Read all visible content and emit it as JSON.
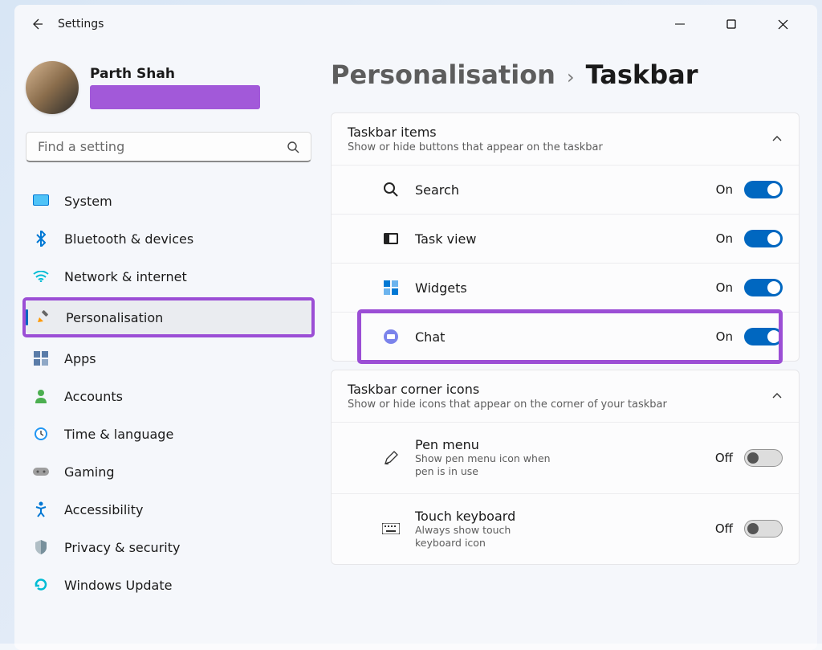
{
  "app_title": "Settings",
  "profile": {
    "name": "Parth Shah"
  },
  "search": {
    "placeholder": "Find a setting"
  },
  "sidebar": {
    "items": [
      {
        "label": "System"
      },
      {
        "label": "Bluetooth & devices"
      },
      {
        "label": "Network & internet"
      },
      {
        "label": "Personalisation"
      },
      {
        "label": "Apps"
      },
      {
        "label": "Accounts"
      },
      {
        "label": "Time & language"
      },
      {
        "label": "Gaming"
      },
      {
        "label": "Accessibility"
      },
      {
        "label": "Privacy & security"
      },
      {
        "label": "Windows Update"
      }
    ]
  },
  "breadcrumb": {
    "parent": "Personalisation",
    "current": "Taskbar"
  },
  "section1": {
    "title": "Taskbar items",
    "subtitle": "Show or hide buttons that appear on the taskbar",
    "rows": [
      {
        "label": "Search",
        "state": "On"
      },
      {
        "label": "Task view",
        "state": "On"
      },
      {
        "label": "Widgets",
        "state": "On"
      },
      {
        "label": "Chat",
        "state": "On"
      }
    ]
  },
  "section2": {
    "title": "Taskbar corner icons",
    "subtitle": "Show or hide icons that appear on the corner of your taskbar",
    "rows": [
      {
        "label": "Pen menu",
        "sub": "Show pen menu icon when pen is in use",
        "state": "Off"
      },
      {
        "label": "Touch keyboard",
        "sub": "Always show touch keyboard icon",
        "state": "Off"
      }
    ]
  }
}
